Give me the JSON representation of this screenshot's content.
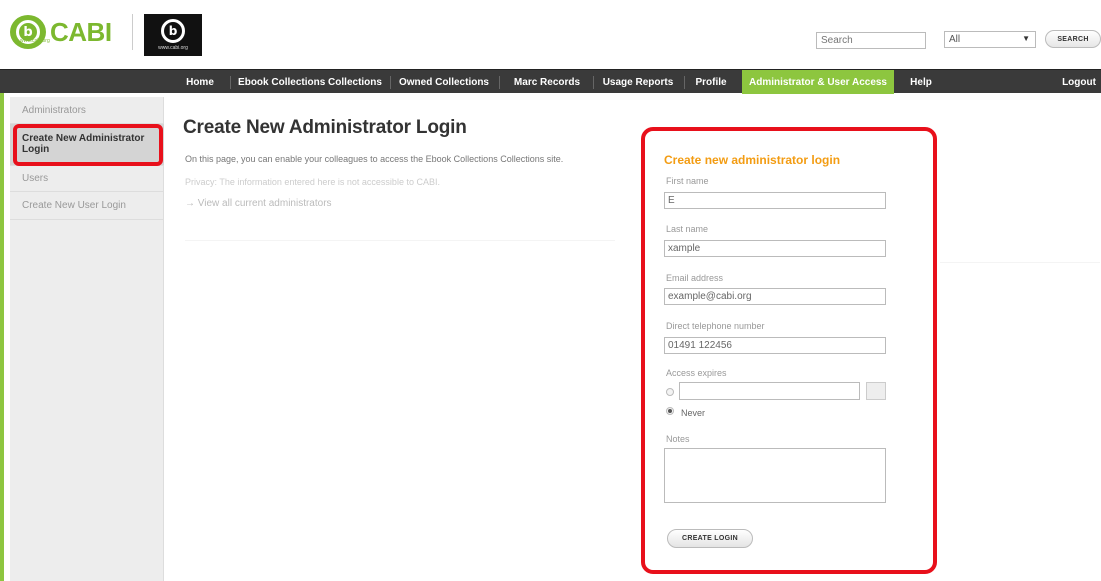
{
  "header": {
    "logo_text": "CABI",
    "logo_sub": "www.cabi.org",
    "logo2_sub": "www.cabi.org",
    "search_placeholder": "Search",
    "search_scope": "All",
    "search_button": "SEARCH"
  },
  "nav": {
    "items": [
      {
        "label": "Home"
      },
      {
        "label": "Ebook Collections Collections"
      },
      {
        "label": "Owned Collections"
      },
      {
        "label": "Marc Records"
      },
      {
        "label": "Usage Reports"
      },
      {
        "label": "Profile"
      },
      {
        "label": "Administrator & User Access",
        "active": true
      },
      {
        "label": "Help"
      },
      {
        "label": "Logout"
      }
    ]
  },
  "sidebar": {
    "items": [
      {
        "label": "Administrators"
      },
      {
        "label": "Create New Administrator Login",
        "selected": true
      },
      {
        "label": "Users"
      },
      {
        "label": "Create New User Login"
      }
    ]
  },
  "main": {
    "title": "Create New Administrator Login",
    "intro": "On this page, you can enable your colleagues to access the Ebook Collections Collections site.",
    "privacy": "Privacy: The information entered here is not accessible to CABI.",
    "view_all": "→ View all current administrators"
  },
  "form": {
    "title": "Create new administrator login",
    "first_name_label": "First name",
    "first_name_value": "E",
    "last_name_label": "Last name",
    "last_name_value": "xample",
    "email_label": "Email address",
    "email_value": "example@cabi.org",
    "phone_label": "Direct telephone number",
    "phone_value": "01491 122456",
    "access_label": "Access expires",
    "never_label": "Never",
    "notes_label": "Notes",
    "submit_label": "CREATE LOGIN"
  },
  "colors": {
    "brand_green": "#8dc63f",
    "nav_bg": "#3a3a3a",
    "highlight_red": "#e8101b",
    "form_title_orange": "#f39c12"
  }
}
